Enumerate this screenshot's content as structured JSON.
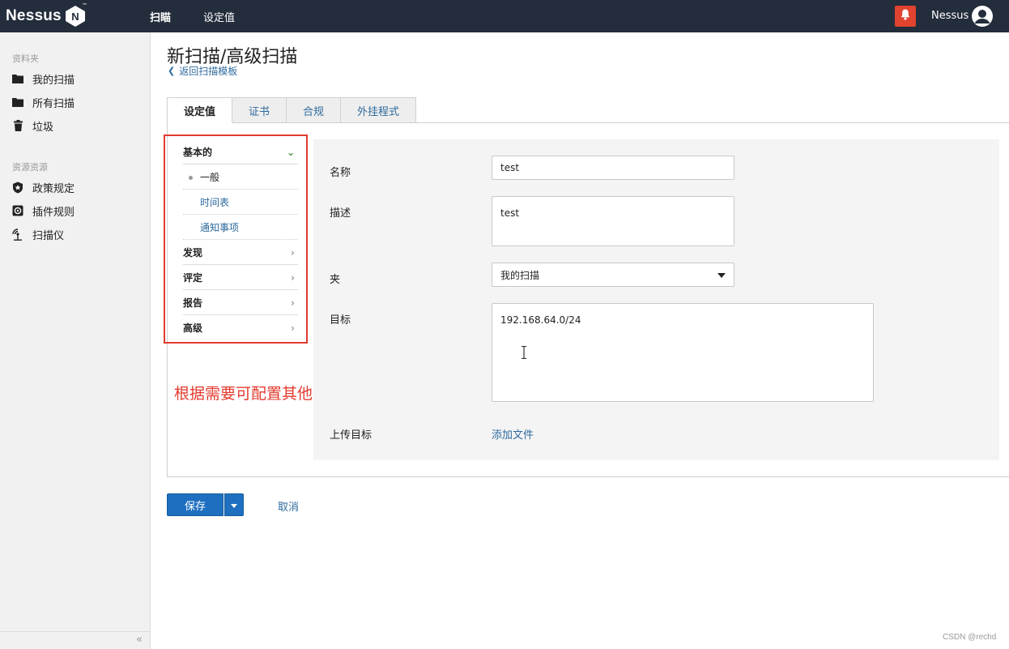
{
  "topbar": {
    "logo_text": "Nessus",
    "logo_mark": "N",
    "logo_tm": "™",
    "nav": [
      {
        "label": "扫瞄",
        "active": true
      },
      {
        "label": "设定值",
        "active": false
      }
    ],
    "user_name": "Nessus",
    "icons": {
      "bell": "bell-icon",
      "user": "user-avatar-icon"
    },
    "colors": {
      "bar": "#232d3b",
      "bell": "#e0432f"
    }
  },
  "sidebar": {
    "section_folders": "资料夹",
    "folders": [
      {
        "label": "我的扫描",
        "icon": "folder-icon"
      },
      {
        "label": "所有扫描",
        "icon": "folder-icon"
      },
      {
        "label": "垃圾",
        "icon": "trash-icon"
      }
    ],
    "section_resources": "资源资源",
    "resources": [
      {
        "label": "政策规定",
        "icon": "shield-icon"
      },
      {
        "label": "插件规则",
        "icon": "plugin-icon"
      },
      {
        "label": "扫描仪",
        "icon": "scanner-icon"
      }
    ],
    "collapse": "«"
  },
  "main": {
    "title": "新扫描/高级扫描",
    "back_link": "返回扫描模板",
    "tabs": [
      {
        "label": "设定值",
        "active": true
      },
      {
        "label": "证书",
        "active": false
      },
      {
        "label": "合规",
        "active": false
      },
      {
        "label": "外挂程式",
        "active": false
      }
    ],
    "subnav": {
      "basic": "基本的",
      "basic_children": [
        "一般",
        "时间表",
        "通知事项"
      ],
      "groups": [
        "发现",
        "评定",
        "报告",
        "高级"
      ]
    },
    "annotation": "根据需要可配置其他信息",
    "form": {
      "name_label": "名称",
      "name_value": "test",
      "desc_label": "描述",
      "desc_value": "test",
      "folder_label": "夹",
      "folder_value": "我的扫描",
      "target_label": "目标",
      "target_value": "192.168.64.0/24",
      "upload_label": "上传目标",
      "add_file": "添加文件"
    },
    "save": "保存",
    "cancel": "取消"
  },
  "watermark": "CSDN @rechd",
  "colors": {
    "link": "#2e6a9e",
    "primary": "#1e6fbf",
    "annotation": "#e23a2f"
  }
}
